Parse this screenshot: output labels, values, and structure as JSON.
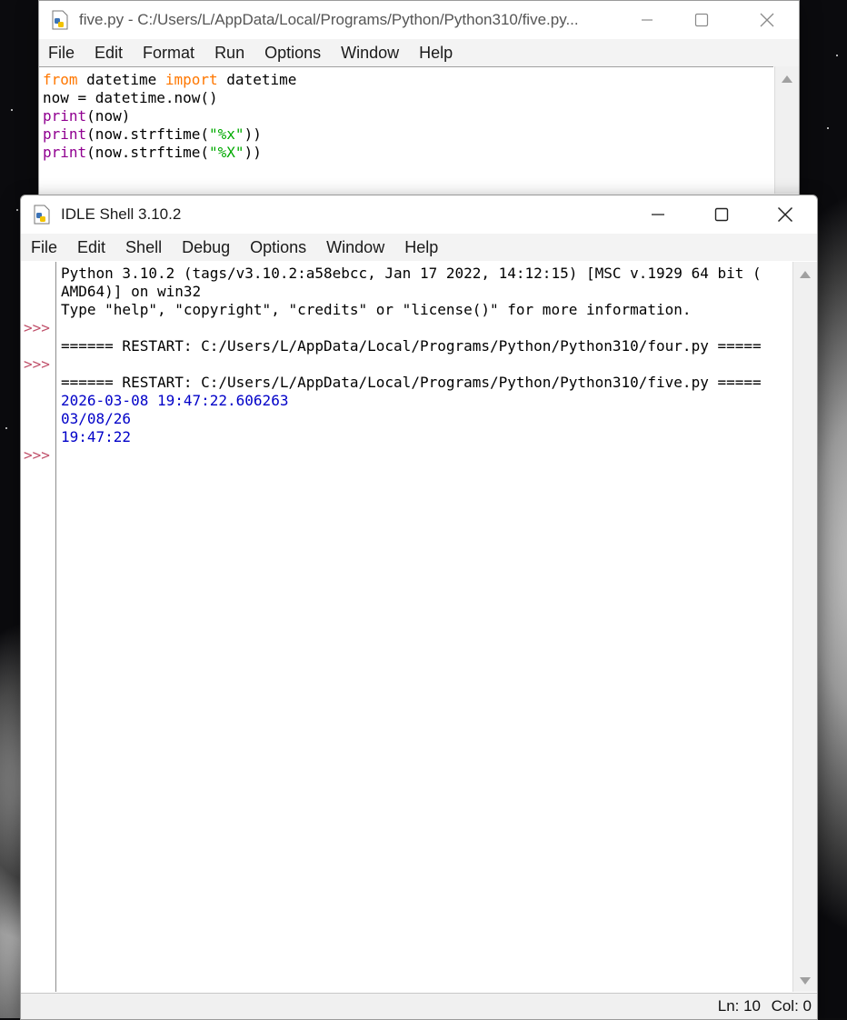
{
  "editor": {
    "title": "five.py - C:/Users/L/AppData/Local/Programs/Python/Python310/five.py...",
    "menu": [
      "File",
      "Edit",
      "Format",
      "Run",
      "Options",
      "Window",
      "Help"
    ],
    "code": {
      "line1_kw1": "from",
      "line1_mid": " datetime ",
      "line1_kw2": "import",
      "line1_end": " datetime",
      "line2": "now = datetime.now()",
      "line3_fn": "print",
      "line3_rest": "(now)",
      "line4_fn": "print",
      "line4_mid": "(now.strftime(",
      "line4_str": "\"%x\"",
      "line4_end": "))",
      "line5_fn": "print",
      "line5_mid": "(now.strftime(",
      "line5_str": "\"%X\"",
      "line5_end": "))"
    }
  },
  "shell": {
    "title": "IDLE Shell 3.10.2",
    "menu": [
      "File",
      "Edit",
      "Shell",
      "Debug",
      "Options",
      "Window",
      "Help"
    ],
    "prompt": ">>>",
    "lines": {
      "banner1": "Python 3.10.2 (tags/v3.10.2:a58ebcc, Jan 17 2022, 14:12:15) [MSC v.1929 64 bit (",
      "banner2": "AMD64)] on win32",
      "banner3": "Type \"help\", \"copyright\", \"credits\" or \"license()\" for more information.",
      "restart1": "====== RESTART: C:/Users/L/AppData/Local/Programs/Python/Python310/four.py =====",
      "restart2": "====== RESTART: C:/Users/L/AppData/Local/Programs/Python/Python310/five.py =====",
      "out1": "2026-03-08 19:47:22.606263",
      "out2": "03/08/26",
      "out3": "19:47:22"
    },
    "status": {
      "ln": "Ln: 10",
      "col": "Col: 0"
    }
  },
  "icons": {
    "app": "python-file-icon",
    "minimize": "minimize-icon",
    "maximize": "maximize-icon",
    "close": "close-icon"
  }
}
